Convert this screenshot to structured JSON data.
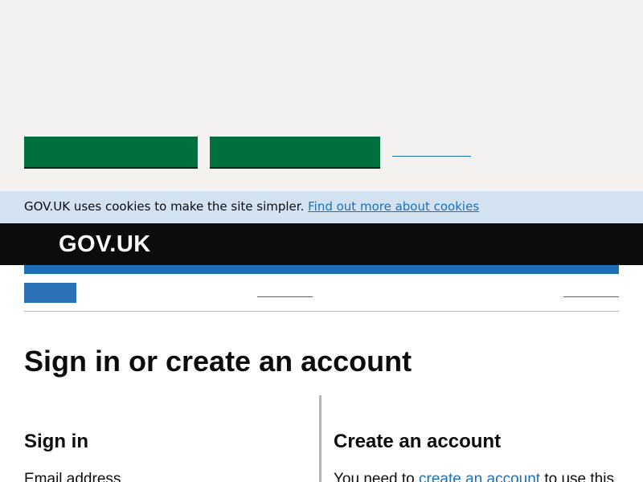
{
  "cookie_message": {
    "text": "GOV.UK uses cookies to make the site simpler.",
    "link": "Find out more about cookies"
  },
  "header": {
    "logo": "GOV.UK"
  },
  "main": {
    "title": "Sign in or create an account",
    "sign_in": {
      "heading": "Sign in",
      "email_label": "Email address"
    },
    "create_account": {
      "heading": "Create an account",
      "text_before": "You need to",
      "link": "create an account",
      "text_after": "to use this"
    }
  },
  "colors": {
    "green": "#00703c",
    "link_blue": "#1d70b8",
    "header_black": "#0b0c0c",
    "cookie_strip": "#d2e2f1",
    "panel_grey": "#f3f2f1"
  }
}
